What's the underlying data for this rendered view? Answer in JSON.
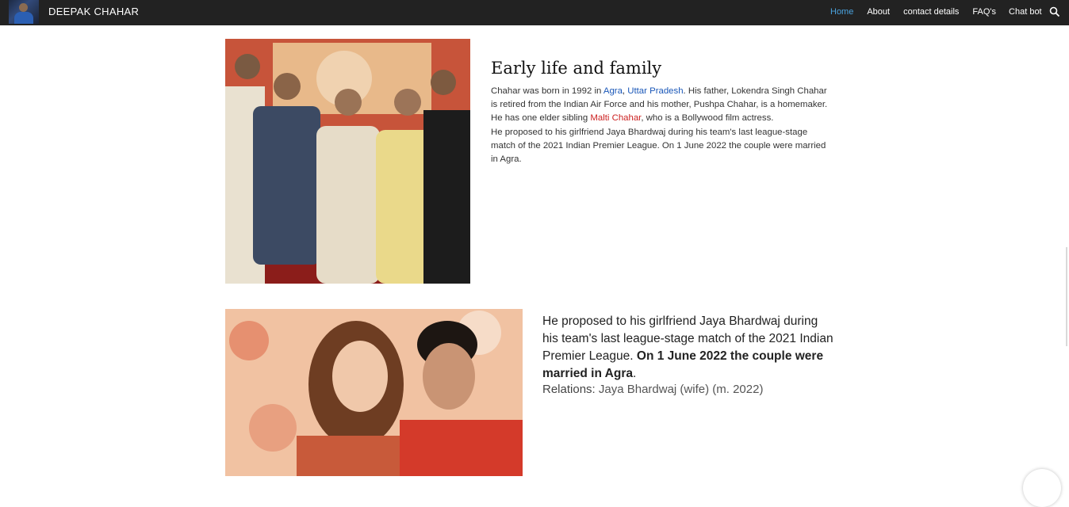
{
  "navbar": {
    "brand": "DEEPAK CHAHAR",
    "links": [
      "Home",
      "About",
      "contact details",
      "FAQ's",
      "Chat bot"
    ],
    "active": "Home",
    "search_icon": "search-icon"
  },
  "section1": {
    "heading": "Early life and family",
    "p1": {
      "t1": "Chahar was born in 1992 in ",
      "agra": "Agra",
      "comma": ", ",
      "up": "Uttar Pradesh",
      "t2": ". His father, Lokendra Singh Chahar is retired from the Indian Air Force and his mother, Pushpa Chahar, is a homemaker. He has one elder sibling ",
      "malti": "Malti Chahar",
      "t3": ", who is a Bollywood film actress."
    },
    "p2": "He proposed to his girlfriend Jaya Bhardwaj during his team's last league-stage match of the 2021 Indian Premier League. On 1 June 2022 the couple were married in Agra."
  },
  "section2": {
    "text": "He proposed to his girlfriend Jaya Bhardwaj during his team's last league-stage match of the 2021 Indian Premier League. ",
    "bold": "On 1 June 2022 the couple were married in Agra",
    "period": ".",
    "relations_label": "Relations: ",
    "relations_value": "Jaya Bhardwaj (wife)  (m. 2022)"
  },
  "colors": {
    "navbar_bg": "#222222",
    "active_link": "#4aa3df",
    "link_blue": "#1a57b8",
    "link_red": "#cc2222"
  }
}
